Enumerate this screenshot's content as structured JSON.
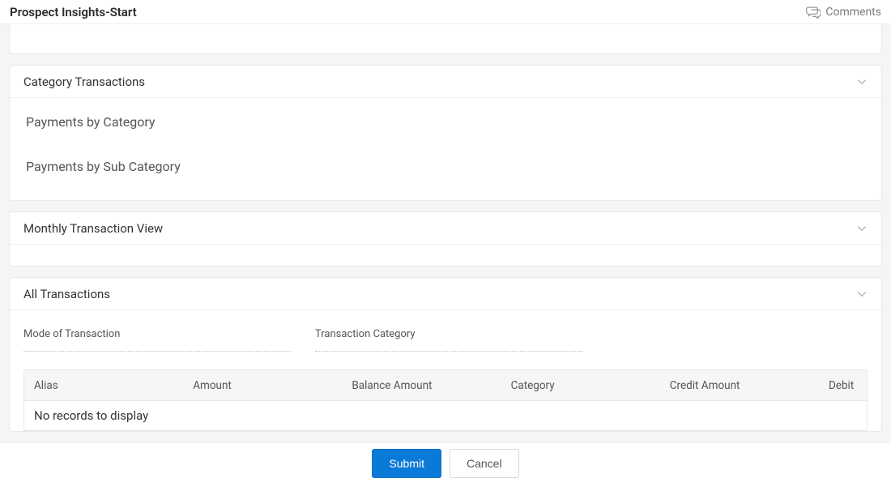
{
  "header": {
    "title": "Prospect Insights-Start",
    "comments_label": "Comments"
  },
  "panels": {
    "category_transactions": {
      "title": "Category Transactions",
      "items": [
        "Payments by Category",
        "Payments by Sub Category"
      ]
    },
    "monthly_view": {
      "title": "Monthly Transaction View"
    },
    "all_transactions": {
      "title": "All Transactions",
      "filters": {
        "mode_label": "Mode of Transaction",
        "category_label": "Transaction Category"
      },
      "columns": [
        "Alias",
        "Amount",
        "Balance Amount",
        "Category",
        "Credit Amount",
        "Debit"
      ],
      "no_records": "No records to display"
    }
  },
  "footer": {
    "submit": "Submit",
    "cancel": "Cancel"
  }
}
